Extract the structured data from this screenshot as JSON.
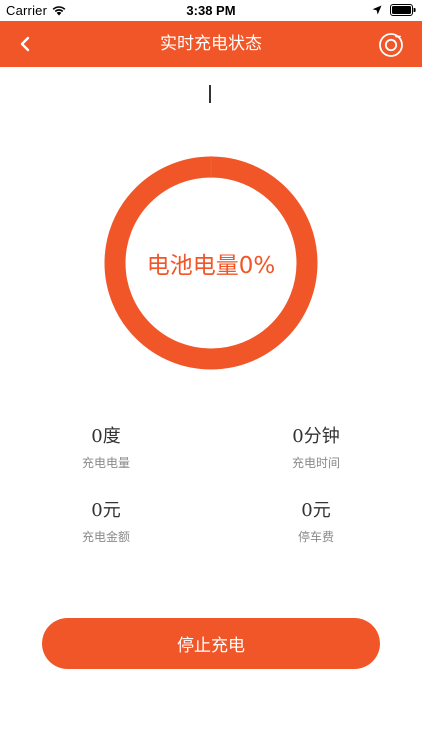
{
  "status_bar": {
    "carrier": "Carrier",
    "time": "3:38 PM",
    "icons": [
      "wifi-icon",
      "location-arrow-icon",
      "battery-icon"
    ]
  },
  "nav": {
    "title": "实时充电状态",
    "back_icon": "chevron-left-icon",
    "right_icon": "camera-icon"
  },
  "battery": {
    "label": "电池电量0%",
    "percent": 0
  },
  "stats": {
    "energy": {
      "value": "0度",
      "label": "充电电量"
    },
    "duration": {
      "value": "0分钟",
      "label": "充电时间"
    },
    "amount": {
      "value": "0元",
      "label": "充电金额"
    },
    "parking": {
      "value": "0元",
      "label": "停车费"
    }
  },
  "actions": {
    "stop_label": "停止充电"
  },
  "colors": {
    "accent": "#f05628",
    "text_primary": "#333333",
    "text_secondary": "#8a8a8a",
    "background": "#ffffff"
  }
}
